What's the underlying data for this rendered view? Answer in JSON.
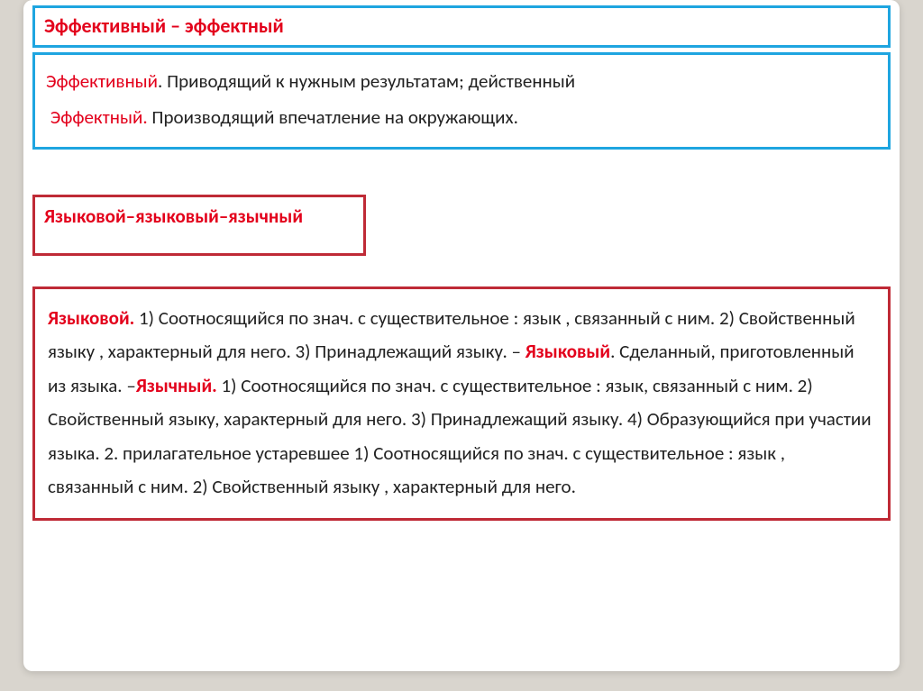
{
  "section1": {
    "title": "Эффективный – эффектный",
    "term1": "Эффективный",
    "def1": ".  Приводящий к нужным результатам; действенный",
    "term2": "Эффектный.",
    "def2": "  Производящий впечатление на окружающих."
  },
  "section2": {
    "title": "Языковой–языковый–язычный",
    "term1": "Языковой.",
    "part1": " 1) Соотносящийся по знач. с существительное : язык , связанный с ним. 2) Свойственный языку , характерный для него. 3) Принадлежащий языку. – ",
    "term2": "Языковый",
    "part2": ". Сделанный, приготовленный из языка. –",
    "term3": "Язычный.",
    "part3": "  1) Соотносящийся по знач. с существительное : язык, связанный с ним. 2) Свойственный языку, характерный для него. 3) Принадлежащий языку. 4) Образующийся при участии языка. 2. прилагательное устаревшее 1) Соотносящийся по знач. с существительное : язык , связанный с ним. 2) Свойственный языку , характерный для него."
  }
}
